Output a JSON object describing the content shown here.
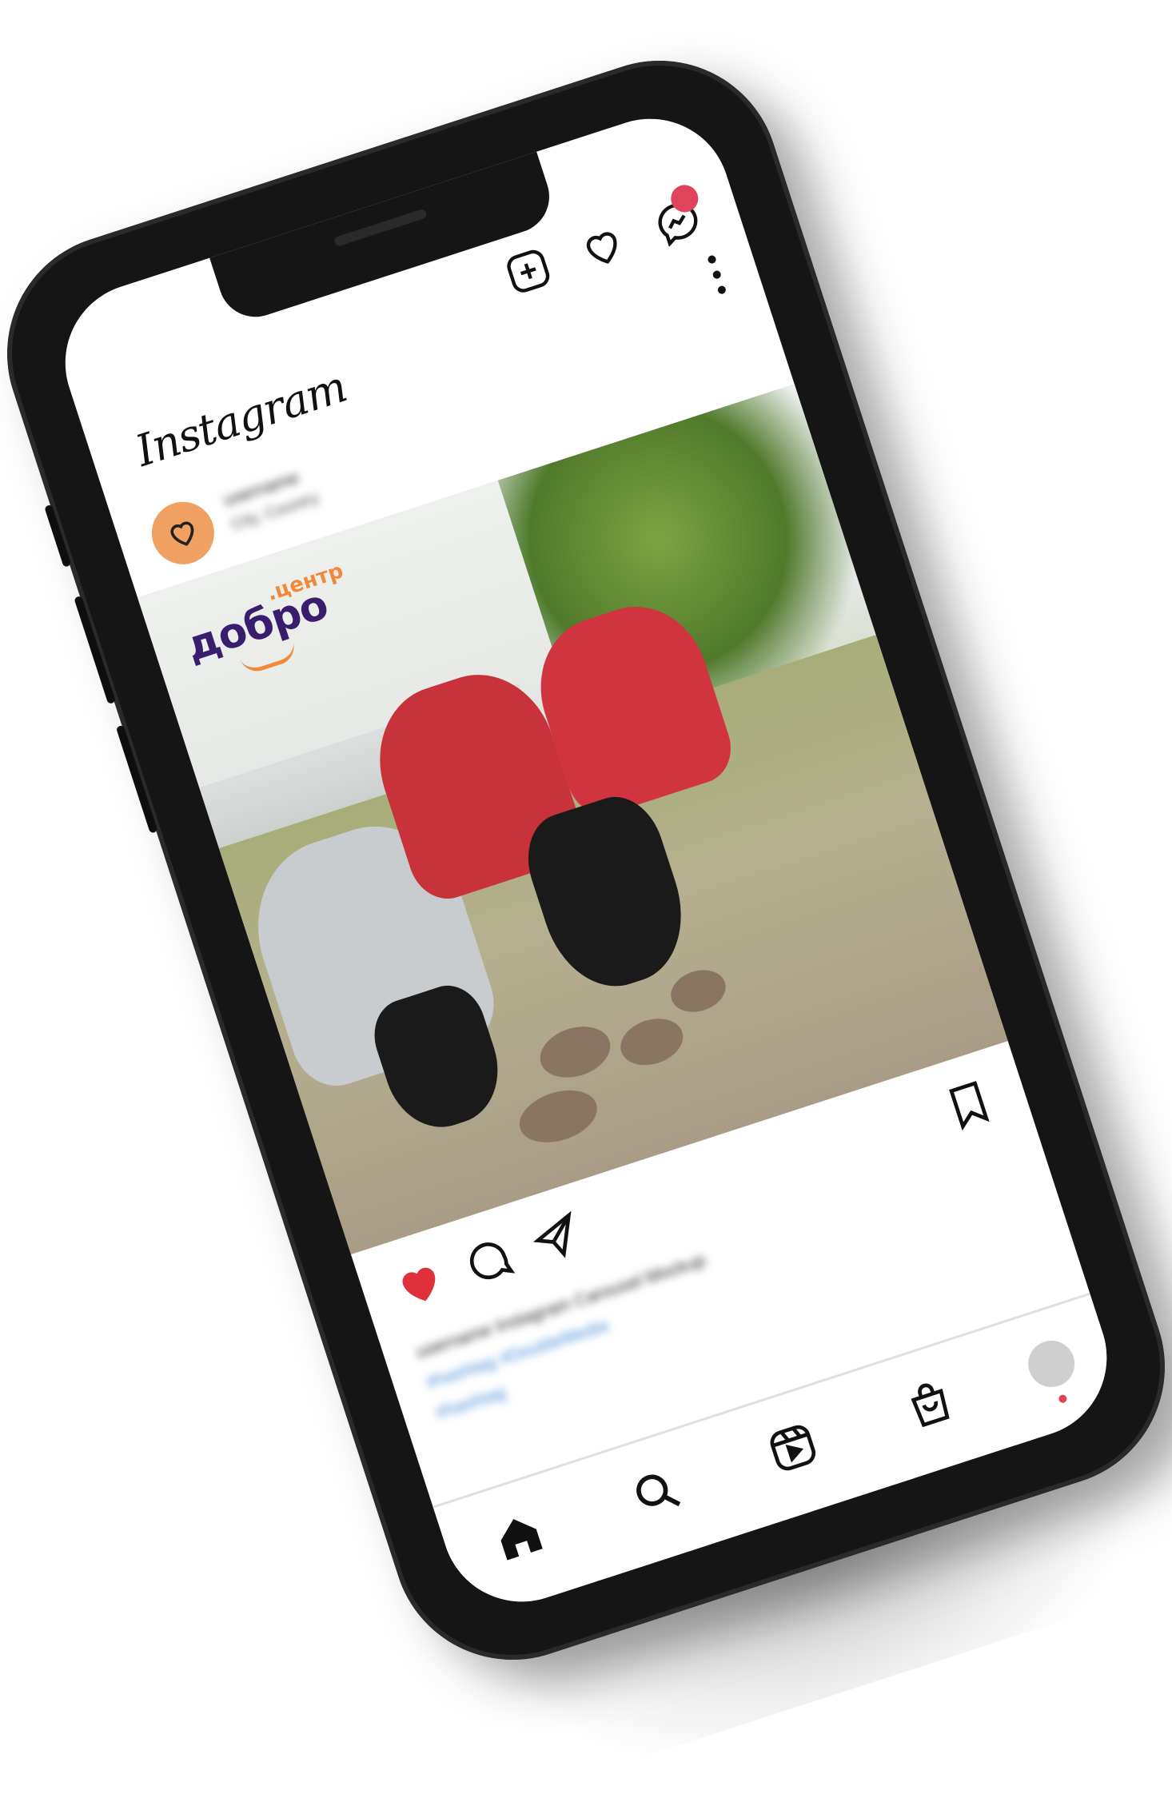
{
  "app": {
    "name": "Instagram"
  },
  "post": {
    "username": "username",
    "location": "City, Country",
    "brand_logo": {
      "main": "добро",
      "sub": ".центр"
    },
    "caption_line1": "username Instagram Carousel Mockup",
    "caption_hashtags_1": "#hashtag #DoubleMedia",
    "caption_hashtags_2": "#hashtag"
  },
  "icons": {
    "new_post": "plus-square-icon",
    "activity": "heart-outline-icon",
    "messenger": "messenger-icon",
    "more": "more-vertical-icon",
    "like": "heart-filled-icon",
    "comment": "comment-icon",
    "share": "send-icon",
    "save": "bookmark-icon",
    "home": "home-icon",
    "search": "search-icon",
    "reels": "reels-icon",
    "shop": "shop-icon",
    "profile": "profile-avatar"
  },
  "colors": {
    "badge": "#e0445a",
    "like": "#e0303c",
    "avatar": "#f0a060",
    "brand_primary": "#3a1e6e",
    "brand_accent": "#f08a3a",
    "hashtag": "#4a8fd6"
  }
}
